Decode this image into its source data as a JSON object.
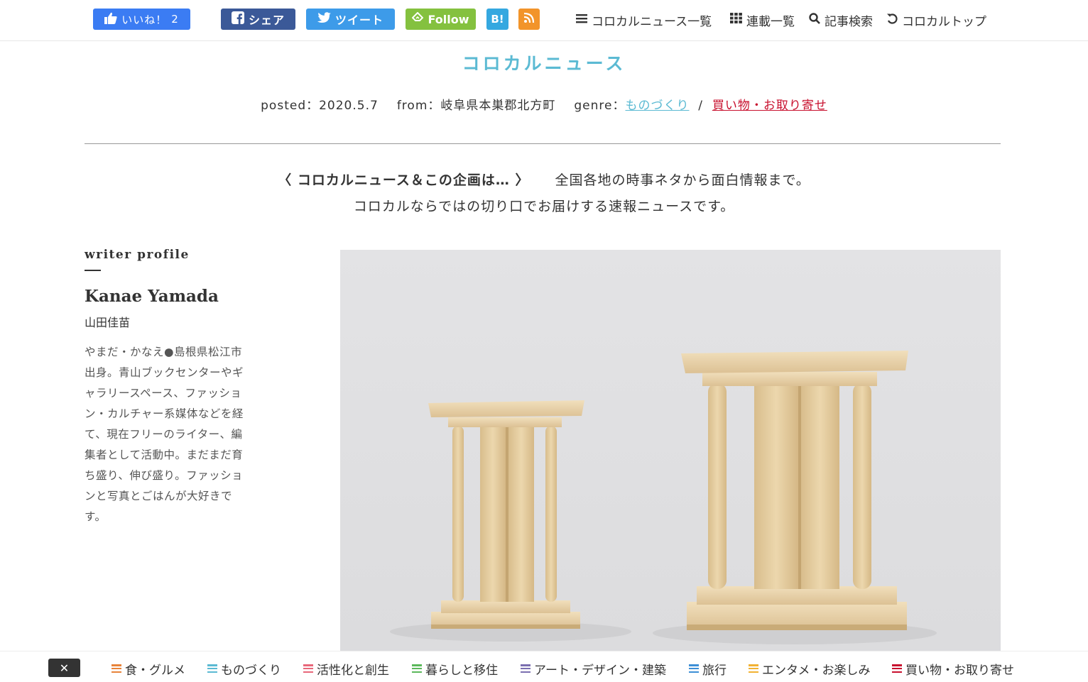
{
  "social": {
    "like_label": "いいね！",
    "like_count": "2",
    "share_label": "シェア",
    "tweet_label": "ツイート",
    "follow_label": "Follow",
    "hatena_label": "B!"
  },
  "nav": {
    "list_label": "コロカルニュース一覧",
    "series_label": "連載一覧",
    "search_label": "記事検索",
    "top_label": "コロカルトップ"
  },
  "header": {
    "brand": "コロカルニュース",
    "posted_label": "posted：",
    "posted_date": "2020.5.7",
    "from_label": "from：",
    "from_place": "岐阜県本巣郡北方町",
    "genre_label": "genre：",
    "genre1": "ものづくり",
    "genre_sep": "/",
    "genre2": "買い物・お取り寄せ"
  },
  "about": {
    "title": "〈 コロカルニュース＆この企画は… 〉",
    "line1": "全国各地の時事ネタから面白情報まで。",
    "line2": "コロカルならではの切り口でお届けする速報ニュースです。"
  },
  "writer": {
    "heading": "writer profile",
    "name_en": "Kanae Yamada",
    "name_ja": "山田佳苗",
    "bio": "やまだ・かなえ●島根県松江市出身。青山ブックセンターやギャラリースペース、ファッション・カルチャー系媒体などを経て、現在フリーのライター、編集者として活動中。まだまだ育ち盛り、伸び盛り。ファッションと写真とごはんが大好きです。"
  },
  "bottom": {
    "close_label": "✕",
    "categories": [
      {
        "label": "食・グルメ",
        "color": "#e8833a"
      },
      {
        "label": "ものづくり",
        "color": "#5bbad3"
      },
      {
        "label": "活性化と創生",
        "color": "#e8677a"
      },
      {
        "label": "暮らしと移住",
        "color": "#5bb85b"
      },
      {
        "label": "アート・デザイン・建築",
        "color": "#7b6fb0"
      },
      {
        "label": "旅行",
        "color": "#3d8fd6"
      },
      {
        "label": "エンタメ・お楽しみ",
        "color": "#f2b233"
      },
      {
        "label": "買い物・お取り寄せ",
        "color": "#c8102e"
      }
    ]
  },
  "colors": {
    "brand": "#5bbad3",
    "facebook_like": "#3b7cf3",
    "facebook_share": "#3b5998",
    "twitter": "#3d9be9",
    "feedly": "#84c13f",
    "hatena": "#35a8e0",
    "rss": "#f2942a"
  }
}
